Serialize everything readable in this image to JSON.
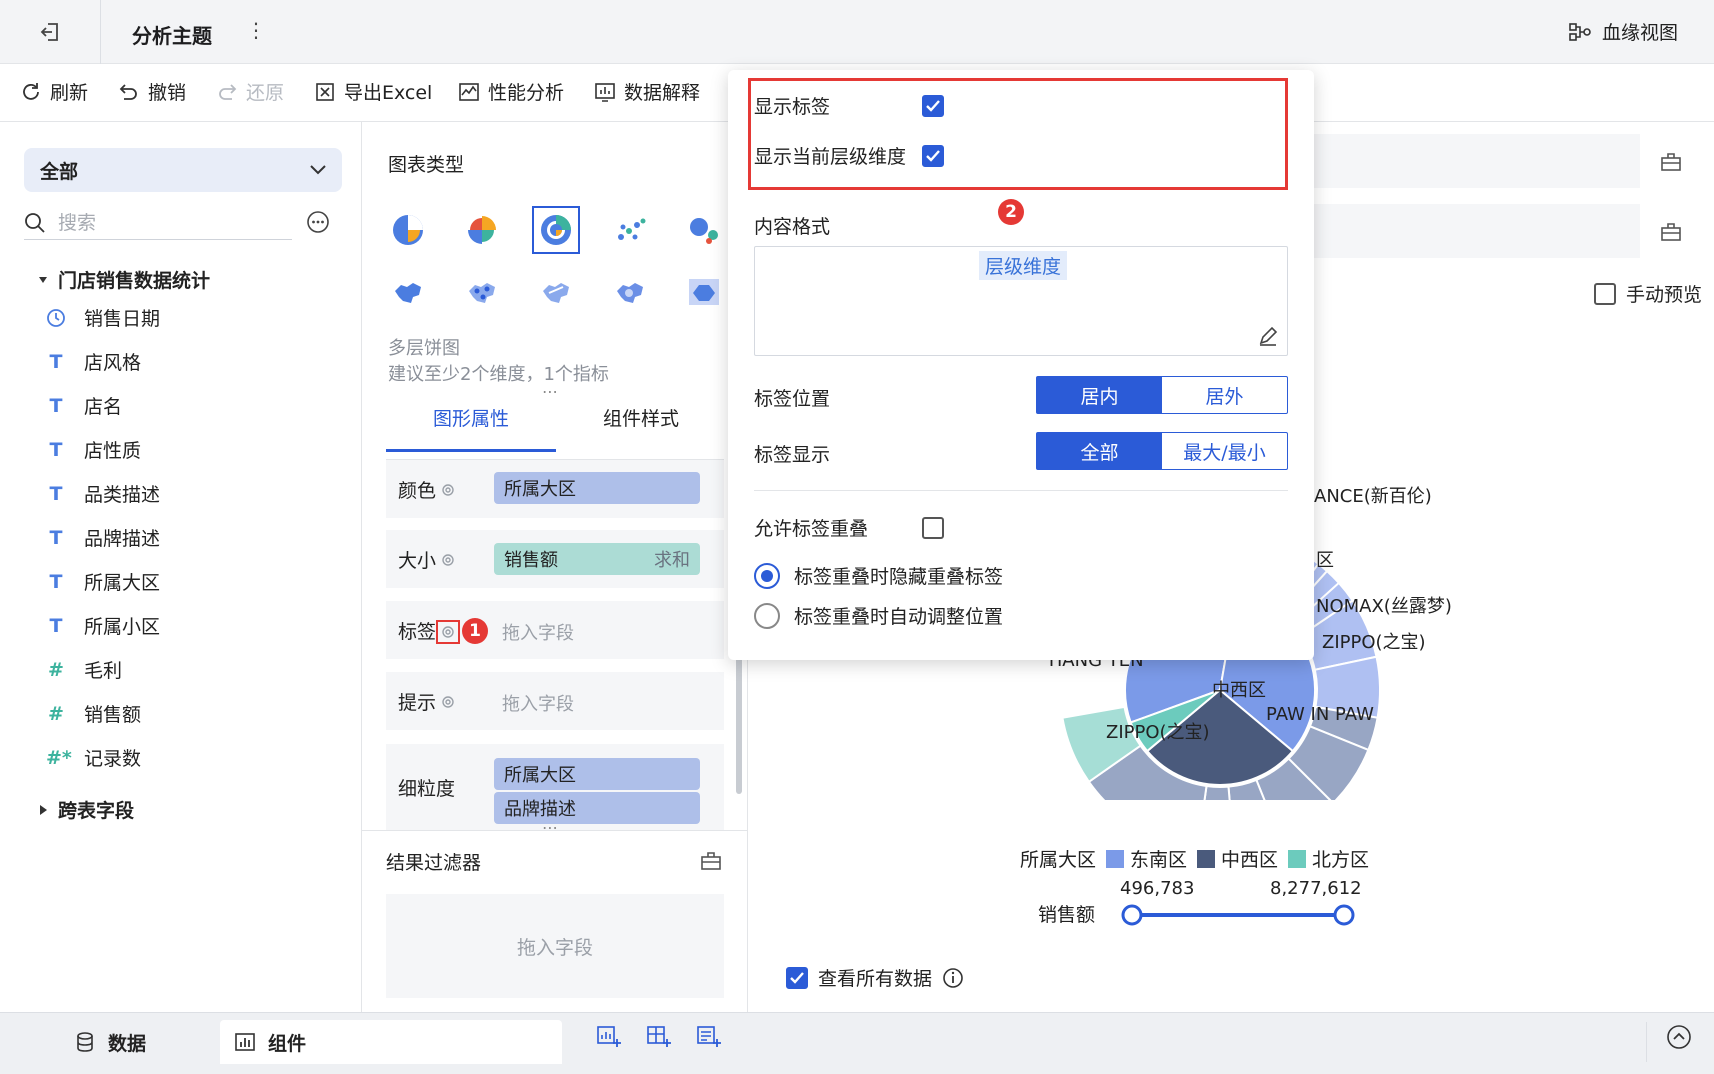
{
  "header": {
    "title": "分析主题",
    "more": "⋮",
    "lineage_label": "血缘视图"
  },
  "toolbar": {
    "refresh": "刷新",
    "undo": "撤销",
    "redo": "还原",
    "export": "导出Excel",
    "perf": "性能分析",
    "explain": "数据解释"
  },
  "left": {
    "scope": "全部",
    "search_placeholder": "搜索",
    "group": "门店销售数据统计",
    "fields": [
      {
        "icon": "clock-icon",
        "type": "date",
        "label": "销售日期"
      },
      {
        "icon": "text-type-icon",
        "type": "T",
        "label": "店风格"
      },
      {
        "icon": "text-type-icon",
        "type": "T",
        "label": "店名"
      },
      {
        "icon": "text-type-icon",
        "type": "T",
        "label": "店性质"
      },
      {
        "icon": "text-type-icon",
        "type": "T",
        "label": "品类描述"
      },
      {
        "icon": "text-type-icon",
        "type": "T",
        "label": "品牌描述"
      },
      {
        "icon": "text-type-icon",
        "type": "T",
        "label": "所属大区"
      },
      {
        "icon": "text-type-icon",
        "type": "T",
        "label": "所属小区"
      },
      {
        "icon": "number-type-icon",
        "type": "#",
        "label": "毛利"
      },
      {
        "icon": "number-type-icon",
        "type": "#",
        "label": "销售额"
      },
      {
        "icon": "record-count-icon",
        "type": "#*",
        "label": "记录数"
      }
    ],
    "group2": "跨表字段"
  },
  "mid": {
    "chart_type_label": "图表类型",
    "chart_name": "多层饼图",
    "chart_hint": "建议至少2个维度，1个指标",
    "tabs": [
      "图形属性",
      "组件样式"
    ],
    "slots": {
      "color": {
        "label": "颜色",
        "field": "所属大区"
      },
      "size": {
        "label": "大小",
        "field": "销售额",
        "agg": "求和"
      },
      "label": {
        "label": "标签",
        "placeholder": "拖入字段"
      },
      "tooltip": {
        "label": "提示",
        "placeholder": "拖入字段"
      },
      "granularity": {
        "label": "细粒度",
        "fields": [
          "所属大区",
          "品牌描述"
        ]
      }
    },
    "badge1": "1",
    "filter_title": "结果过滤器",
    "filter_placeholder": "拖入字段"
  },
  "popup": {
    "show_label": "显示标签",
    "show_level_dim": "显示当前层级维度",
    "badge2": "2",
    "content_format": "内容格式",
    "content_token": "层级维度",
    "label_position": "标签位置",
    "pos_options": [
      "居内",
      "居外"
    ],
    "label_display": "标签显示",
    "display_options": [
      "全部",
      "最大/最小"
    ],
    "allow_overlap": "允许标签重叠",
    "radio1": "标签重叠时隐藏重叠标签",
    "radio2": "标签重叠时自动调整位置"
  },
  "right": {
    "manual_preview": "手动预览",
    "chart_labels": [
      "ANCE(新百伦)",
      "区",
      "NOMAX(丝露梦)",
      "ZIPPO(之宝)",
      "YIANG YEN",
      "中西区",
      "PAW IN PAW",
      "ZIPPO(之宝)"
    ],
    "legend_title": "所属大区",
    "legend": [
      {
        "name": "东南区",
        "color": "#7b9ae8"
      },
      {
        "name": "中西区",
        "color": "#4a5a7c"
      },
      {
        "name": "北方区",
        "color": "#6ccbbd"
      }
    ],
    "range_label": "销售额",
    "range_min": "496,783",
    "range_max": "8,277,612",
    "view_all": "查看所有数据"
  },
  "bottom": {
    "data_tab": "数据",
    "component_tab": "组件"
  }
}
